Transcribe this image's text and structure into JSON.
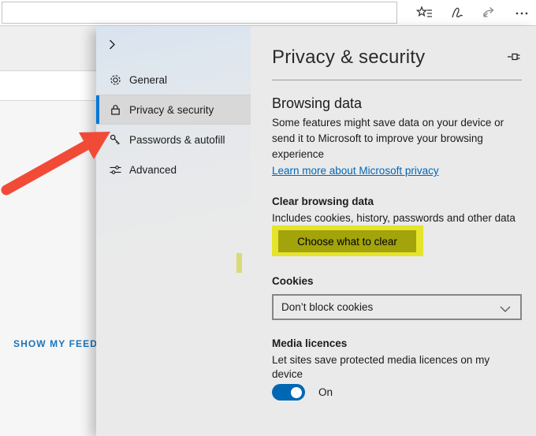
{
  "browser_bar": {
    "address_value": "",
    "icons": [
      "favorites-hub",
      "web-notes",
      "share",
      "more"
    ]
  },
  "page_behind": {
    "show_my_feed_label": "SHOW MY FEED"
  },
  "sidebar": {
    "items": [
      {
        "label": "General",
        "icon": "gear-icon",
        "selected": false
      },
      {
        "label": "Privacy & security",
        "icon": "lock-icon",
        "selected": true
      },
      {
        "label": "Passwords & autofill",
        "icon": "key-icon",
        "selected": false
      },
      {
        "label": "Advanced",
        "icon": "sliders-icon",
        "selected": false
      }
    ]
  },
  "panel": {
    "title": "Privacy & security",
    "browsing_data": {
      "heading": "Browsing data",
      "description": "Some features might save data on your device or send it to Microsoft to improve your browsing experience",
      "link_label": "Learn more about Microsoft privacy"
    },
    "clear_browsing_data": {
      "heading": "Clear browsing data",
      "description": "Includes cookies, history, passwords and other data",
      "button_label": "Choose what to clear"
    },
    "cookies": {
      "heading": "Cookies",
      "dropdown_value": "Don’t block cookies"
    },
    "media_licences": {
      "heading": "Media licences",
      "description": "Let sites save protected media licences on my device",
      "toggle_label": "On",
      "toggle_state": "on"
    }
  },
  "annotations": {
    "arrow_color": "#f14b38",
    "highlight_color": "#e6e32b"
  },
  "colors": {
    "accent_blue": "#0078d7",
    "link_blue": "#0067b8",
    "toggle_blue": "#0067b4"
  }
}
